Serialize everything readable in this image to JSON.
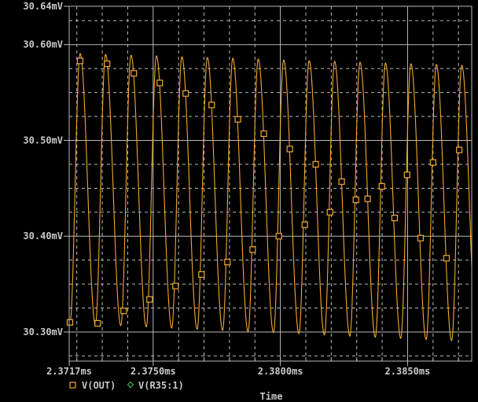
{
  "chart_data": {
    "type": "line",
    "title": "",
    "xlabel": "Time",
    "ylabel": "",
    "xlim": [
      2.3717,
      2.38752
    ],
    "ylim": [
      30.2696,
      30.64
    ],
    "x_unit": "ms",
    "y_unit": "mV",
    "grid": true,
    "x_ticks": [
      {
        "value": 2.3717,
        "label": "2.3717ms"
      },
      {
        "value": 2.375,
        "label": "2.3750ms"
      },
      {
        "value": 2.38,
        "label": "2.3800ms"
      },
      {
        "value": 2.385,
        "label": "2.3850ms"
      }
    ],
    "x_minor_step": 0.001,
    "y_ticks": [
      {
        "value": 30.64,
        "label": "30.64mV"
      },
      {
        "value": 30.6,
        "label": "30.60mV"
      },
      {
        "value": 30.5,
        "label": "30.50mV"
      },
      {
        "value": 30.4,
        "label": "30.40mV"
      },
      {
        "value": 30.3,
        "label": "30.30mV"
      }
    ],
    "y_minor_step": 0.025,
    "legend": {
      "placement": "bottom-left",
      "entries": [
        {
          "name": "V(OUT)",
          "marker": "square",
          "color": "#f0a830"
        },
        {
          "name": "V(R35:1)",
          "marker": "diamond",
          "color": "#3cb44b"
        }
      ]
    },
    "series": [
      {
        "name": "V(OUT)",
        "color": "#f0a830",
        "waveform": {
          "period_ms": 0.001,
          "first_peak_ms": 2.37213,
          "rise_fraction": 0.4,
          "peak_start_mV": 30.591,
          "peak_end_mV": 30.578,
          "trough_start_mV": 30.309,
          "trough_end_mV": 30.29
        },
        "markers": [
          [
            2.37173,
            30.31
          ],
          [
            2.37213,
            30.583
          ],
          [
            2.37282,
            30.309
          ],
          [
            2.37319,
            30.58
          ],
          [
            2.37384,
            30.322
          ],
          [
            2.37424,
            30.57
          ],
          [
            2.37486,
            30.334
          ],
          [
            2.37526,
            30.56
          ],
          [
            2.37588,
            30.348
          ],
          [
            2.37628,
            30.549
          ],
          [
            2.3769,
            30.36
          ],
          [
            2.3773,
            30.537
          ],
          [
            2.37792,
            30.373
          ],
          [
            2.37833,
            30.522
          ],
          [
            2.37891,
            30.386
          ],
          [
            2.37935,
            30.507
          ],
          [
            2.37994,
            30.4
          ],
          [
            2.38037,
            30.491
          ],
          [
            2.38096,
            30.412
          ],
          [
            2.38139,
            30.475
          ],
          [
            2.38195,
            30.425
          ],
          [
            2.38241,
            30.457
          ],
          [
            2.38297,
            30.438
          ],
          [
            2.38343,
            30.439
          ],
          [
            2.38399,
            30.452
          ],
          [
            2.38449,
            30.419
          ],
          [
            2.38498,
            30.464
          ],
          [
            2.38551,
            30.398
          ],
          [
            2.386,
            30.477
          ],
          [
            2.38653,
            30.377
          ],
          [
            2.38703,
            30.49
          ]
        ]
      }
    ],
    "colors": {
      "background": "#000000",
      "grid": "#b8b8b8",
      "text": "#c8c8c8"
    }
  }
}
